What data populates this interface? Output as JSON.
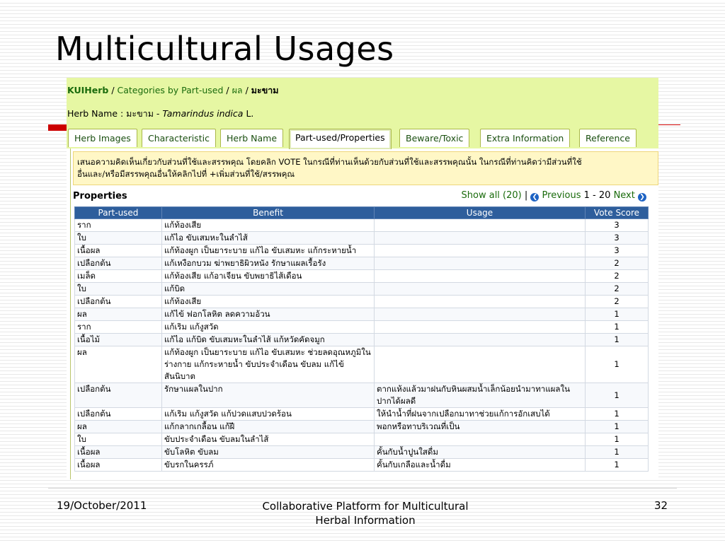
{
  "slide": {
    "title": "Multicultural Usages",
    "footer": {
      "date": "19/October/2011",
      "center_line1": "Collaborative Platform for  Multicultural",
      "center_line2": "Herbal Information",
      "page": "32"
    }
  },
  "app": {
    "breadcrumb": {
      "site": "KUIHerb",
      "sep": "/",
      "category": "Categories by Part-used",
      "part": "ผล",
      "current": "มะขาม"
    },
    "herb_name": {
      "label": "Herb Name : มะขาม -",
      "scientific": "Tamarindus indica",
      "author": "L."
    },
    "tabs": [
      "Herb Images",
      "Characteristic",
      "Herb Name",
      "Part-used/Properties",
      "Beware/Toxic",
      "Extra Information",
      "Reference"
    ],
    "active_tab": "Part-used/Properties",
    "notice_line1": "เสนอความคิดเห็นเกี่ยวกับส่วนที่ใช้และสรรพคุณ โดยคลิก VOTE ในกรณีที่ท่านเห็นด้วยกับส่วนที่ใช้และสรรพคุณนั้น ในกรณีที่ท่านคิดว่ามีส่วนที่ใช้",
    "notice_line2": "อื่นและ/หรือมีสรรพคุณอื่นให้คลิกไปที่ +เพิ่มส่วนที่ใช้/สรรพคุณ",
    "properties_title": "Properties",
    "pager": {
      "show_all": "Show all (20)",
      "sep": "|",
      "prev": "Previous",
      "range": "1 - 20",
      "next": "Next"
    },
    "table": {
      "headers": [
        "Part-used",
        "Benefit",
        "Usage",
        "Vote Score"
      ],
      "rows": [
        {
          "part": "ราก",
          "benefit": "แก้ท้องเสีย",
          "usage": "",
          "score": "3"
        },
        {
          "part": "ใบ",
          "benefit": "แก้ไอ ขับเสมหะในลำไส้",
          "usage": "",
          "score": "3"
        },
        {
          "part": "เนื้อผล",
          "benefit": "แก้ท้องผูก เป็นยาระบาย แก้ไอ ขับเสมหะ แก้กระหายน้ำ",
          "usage": "",
          "score": "3"
        },
        {
          "part": "เปลือกต้น",
          "benefit": "แก้เหงือกบวม ฆ่าพยาธิผิวหนัง รักษาแผลเรื้อรัง",
          "usage": "",
          "score": "2"
        },
        {
          "part": "เมล็ด",
          "benefit": "แก้ท้องเสีย แก้อาเจียน ขับพยาธิไส้เดือน",
          "usage": "",
          "score": "2"
        },
        {
          "part": "ใบ",
          "benefit": "แก้บิด",
          "usage": "",
          "score": "2"
        },
        {
          "part": "เปลือกต้น",
          "benefit": "แก้ท้องเสีย",
          "usage": "",
          "score": "2"
        },
        {
          "part": "ผล",
          "benefit": "แก้ไข้ ฟอกโลหิต ลดความอ้วน",
          "usage": "",
          "score": "1"
        },
        {
          "part": "ราก",
          "benefit": "แก้เริม แก้งูสวัด",
          "usage": "",
          "score": "1"
        },
        {
          "part": "เนื้อไม้",
          "benefit": "แก้ไอ แก้บิด ขับเสมหะในลำไส้ แก้หวัดคัดจมูก",
          "usage": "",
          "score": "1"
        },
        {
          "part": "ผล",
          "benefit": "แก้ท้องผูก เป็นยาระบาย แก้ไอ ขับเสมหะ ช่วยลดอุณหภูมิในร่างกาย แก้กระหายน้ำ ขับประจำเดือน ขับลม แก้ไข้สันนิบาต",
          "usage": "",
          "score": "1"
        },
        {
          "part": "เปลือกต้น",
          "benefit": "รักษาแผลในปาก",
          "usage": "ตากแห้งแล้วมาฝนกับหินผสมน้ำเล็กน้อยนำมาทาแผลในปากได้ผลดี",
          "score": "1"
        },
        {
          "part": "เปลือกต้น",
          "benefit": "แก้เริม แก้งูสวัด แก้ปวดแสบปวดร้อน",
          "usage": "ให้นำน้ำที่ฝนจากเปลือกมาทาช่วยแก้การอักเสบได้",
          "score": "1"
        },
        {
          "part": "ผล",
          "benefit": "แก้กลากเกลื้อน แก้ฝี",
          "usage": "พอกหรือทาบริเวณที่เป็น",
          "score": "1"
        },
        {
          "part": "ใบ",
          "benefit": "ขับประจำเดือน ขับลมในลำไส้",
          "usage": "",
          "score": "1"
        },
        {
          "part": "เนื้อผล",
          "benefit": "ขับโลหิต ขับลม",
          "usage": "คั้นกับน้ำปูนใสดื่ม",
          "score": "1"
        },
        {
          "part": "เนื้อผล",
          "benefit": "ขับรกในครรภ์",
          "usage": "คั้นกับเกลือและน้ำดื่ม",
          "score": "1"
        }
      ]
    }
  },
  "colors": {
    "topbar": "#e6f7a3",
    "table_header": "#2e5e9c",
    "link_green": "#1a6b0c",
    "accent_red": "#cc0000"
  }
}
